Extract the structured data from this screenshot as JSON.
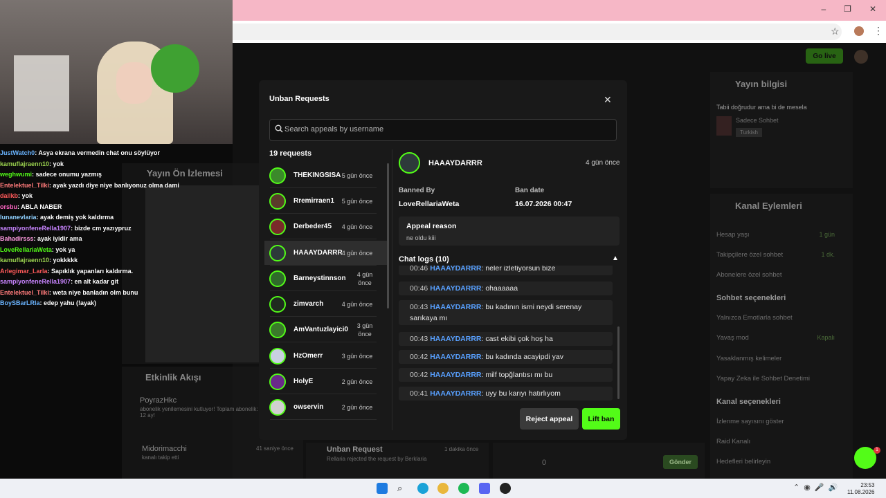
{
  "browser": {
    "window_controls": [
      "–",
      "❐",
      "✕"
    ]
  },
  "app": {
    "go_live_label": "Go live"
  },
  "background_panels": {
    "preview_title": "Yayın Ön İzlemesi",
    "activity_title": "Etkinlik Akışı",
    "stream_info_title": "Yayın bilgisi",
    "stream_info_text": "Tabii doğrudur ama bi de mesela",
    "stream_info_sub": "Sadece Sohbet",
    "stream_info_tag": "Turkish",
    "channel_actions_title": "Kanal Eylemleri",
    "channel_actions": [
      {
        "label": "Hesap yaşı",
        "value": "1 gün"
      },
      {
        "label": "Takipçilere özel sohbet",
        "value": "1 dk."
      },
      {
        "label": "Abonelere özel sohbet",
        "value": ""
      },
      {
        "label": "Sohbet seçenekleri",
        "value": ""
      },
      {
        "label": "Yalnızca Emotlarla sohbet",
        "value": ""
      },
      {
        "label": "Yavaş mod",
        "value": "Kapalı"
      },
      {
        "label": "Yasaklanmış kelimeler",
        "value": ""
      },
      {
        "label": "Yapay Zeka ile Sohbet Denetimi",
        "value": ""
      },
      {
        "label": "Kanal seçenekleri",
        "value": ""
      },
      {
        "label": "İzlenme sayısını göster",
        "value": ""
      },
      {
        "label": "Raid Kanalı",
        "value": ""
      },
      {
        "label": "Hedefleri belirleyin",
        "value": ""
      }
    ],
    "feed": [
      {
        "user": "PoyrazHkc",
        "text": "abonelik yenilemesini kutluyor! Toplam abonelik: 12 ay!"
      },
      {
        "user": "Midorimacchi",
        "text": "kanalı takip etti",
        "time": "41 saniye önce"
      },
      {
        "user": "Unban Request",
        "text": "Rellaria rejected the request by Berklaria",
        "time": "1 dakika önce"
      }
    ],
    "send_label": "Gönder",
    "viewer_count": "0"
  },
  "overlay_chat": [
    {
      "user": "JustWatch0",
      "color": "#6ab4ff",
      "text": ": Asya ekrana vermedin chat onu söylüyor"
    },
    {
      "user": "kamuflajraenn10",
      "color": "#9bd34f",
      "text": ": yok"
    },
    {
      "user": "weghwumi",
      "color": "#53fc18",
      "text": ": sadece onumu yazmış"
    },
    {
      "user": "Entelektuel_Tilki",
      "color": "#ff7a7a",
      "text": ": ayak yazdı diye niye banlıyonuz olma dami"
    },
    {
      "user": "dailkb",
      "color": "#ff5a5a",
      "text": ": yok"
    },
    {
      "user": "orsbu",
      "color": "#ff66c4",
      "text": ": ABLA NABER"
    },
    {
      "user": "lunanevlaria",
      "color": "#8fd0ff",
      "text": ": ayak demiş yok kaldırma"
    },
    {
      "user": "sampiyonfeneRella1907",
      "color": "#c884ff",
      "text": ": bizde cm yazıypruz"
    },
    {
      "user": "Bahadirsss",
      "color": "#ff9ae0",
      "text": ": ayak iyidir ama"
    },
    {
      "user": "LoveRellariaWeta",
      "color": "#53fc18",
      "text": ": yok ya"
    },
    {
      "user": "kamuflajraenn10",
      "color": "#9bd34f",
      "text": ": yokkkkk"
    },
    {
      "user": "Arlegimar_Larla",
      "color": "#ff5a5a",
      "text": ": Sapıklık yapanları kaldırma."
    },
    {
      "user": "sampiyonfeneRella1907",
      "color": "#c884ff",
      "text": ": en alt kadar git"
    },
    {
      "user": "Entelektuel_Tilki",
      "color": "#ff7a7a",
      "text": ": weta niye banladın olm bunu"
    },
    {
      "user": "BoySBarLRla",
      "color": "#6ab4ff",
      "text": ": edep yahu (!ayak)"
    }
  ],
  "modal": {
    "title": "Unban Requests",
    "close_label": "✕",
    "search_placeholder": "Search appeals by username",
    "request_count": "19 requests",
    "requests": [
      {
        "name": "THEKINGSISA",
        "time": "5 gün önce",
        "avatar_color": "#3b8a2a"
      },
      {
        "name": "Rremirraen1",
        "time": "5 gün önce",
        "avatar_color": "#5a3a2a"
      },
      {
        "name": "Derbeder45",
        "time": "4 gün önce",
        "avatar_color": "#7a2a2a"
      },
      {
        "name": "HAAAYDARRR",
        "time": "4 gün önce",
        "avatar_color": "#2d3a3a"
      },
      {
        "name": "Barneystinnson",
        "time": "4 gün önce",
        "avatar_color": "#2f6a2a"
      },
      {
        "name": "zimvarch",
        "time": "4 gün önce",
        "avatar_color": "#1f2a1f"
      },
      {
        "name": "AmVantuzlayici0",
        "time": "3 gün önce",
        "avatar_color": "#3a7a2a"
      },
      {
        "name": "HzOmerr",
        "time": "3 gün önce",
        "avatar_color": "#c8d0e0"
      },
      {
        "name": "HolyE",
        "time": "2 gün önce",
        "avatar_color": "#6a2a8a"
      },
      {
        "name": "owservin",
        "time": "2 gün önce",
        "avatar_color": "#d0d0d0"
      }
    ],
    "selected": {
      "name": "HAAAYDARRR",
      "time": "4 gün önce",
      "banned_by_label": "Banned By",
      "banned_by": "LoveRellariaWeta",
      "ban_date_label": "Ban date",
      "ban_date": "16.07.2026 00:47",
      "appeal_reason_label": "Appeal reason",
      "appeal_reason": "ne oldu kiii",
      "chat_logs_label": "Chat logs (10)",
      "chat_logs": [
        {
          "time": "00:46",
          "user": "HAAAYDARRR",
          "text": "neler izletiyorsun bize"
        },
        {
          "time": "00:46",
          "user": "HAAAYDARRR",
          "text": "ohaaaaaa"
        },
        {
          "time": "00:43",
          "user": "HAAAYDARRR",
          "text": "bu kadının ismi neydi serenay sarıkaya mı"
        },
        {
          "time": "00:43",
          "user": "HAAAYDARRR",
          "text": "cast ekibi çok hoş ha"
        },
        {
          "time": "00:42",
          "user": "HAAAYDARRR",
          "text": "bu kadında acayipdi yav"
        },
        {
          "time": "00:42",
          "user": "HAAAYDARRR",
          "text": "milf topğlantısı mı bu"
        },
        {
          "time": "00:41",
          "user": "HAAAYDARRR",
          "text": "uyy bu karıyı hatırlıyom"
        }
      ]
    },
    "reject_label": "Reject appeal",
    "lift_label": "Lift ban"
  },
  "taskbar": {
    "time": "23:53",
    "date": "11.08.2026"
  },
  "help": {
    "badge": "1"
  }
}
